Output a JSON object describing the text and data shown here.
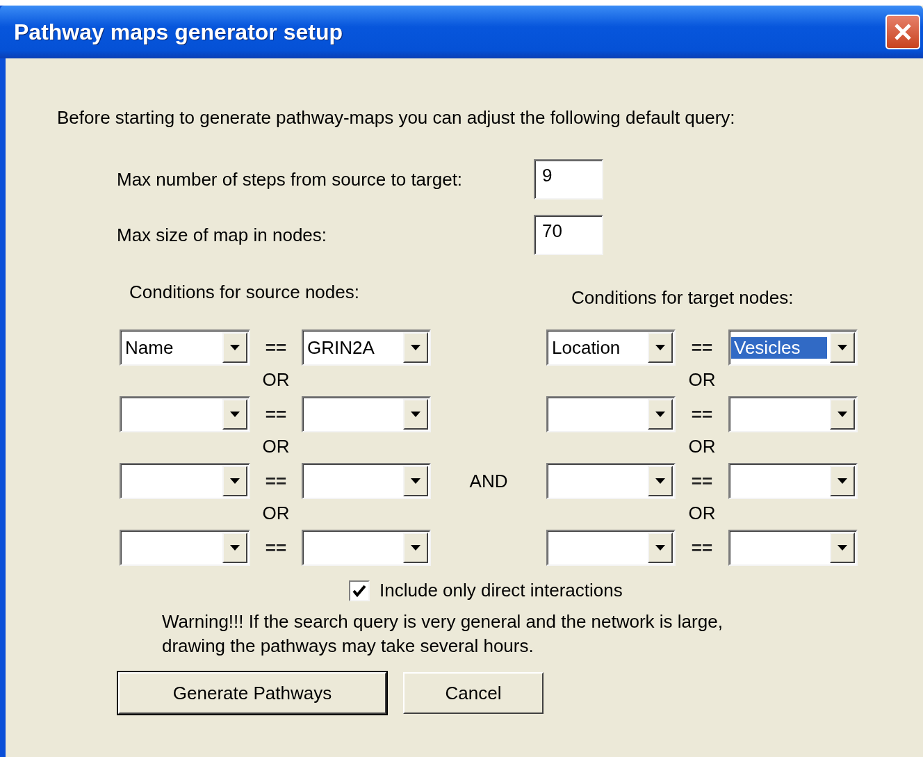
{
  "window": {
    "title": "Pathway maps generator setup"
  },
  "intro": "Before starting to generate pathway-maps you can adjust the following default query:",
  "fields": [
    {
      "label": "Max number of steps from source to target:",
      "value": "9"
    },
    {
      "label": "Max size of map in nodes:",
      "value": "70"
    }
  ],
  "source": {
    "heading": "Conditions for source nodes:",
    "conditions": [
      {
        "field": "Name",
        "operator": "==",
        "value": "GRIN2A",
        "value_highlighted": false
      },
      {
        "joiner": "OR",
        "operator": "=="
      },
      {
        "joiner": "OR",
        "operator": "=="
      },
      {
        "joiner": "OR",
        "operator": "=="
      }
    ]
  },
  "and_label": "AND",
  "target": {
    "heading": "Conditions for target nodes:",
    "conditions": [
      {
        "field": "Location",
        "operator": "==",
        "value": "Vesicles",
        "value_highlighted": true
      },
      {
        "joiner": "OR",
        "operator": "=="
      },
      {
        "joiner": "OR",
        "operator": "=="
      },
      {
        "joiner": "OR",
        "operator": "=="
      }
    ]
  },
  "checkbox": {
    "label": "Include only direct interactions",
    "checked": true
  },
  "warning": "Warning!!! If the search query is very general and the network is large, drawing the pathways may take several hours.",
  "buttons": [
    {
      "label": "Generate Pathways",
      "default": true
    },
    {
      "label": "Cancel",
      "default": false
    }
  ]
}
